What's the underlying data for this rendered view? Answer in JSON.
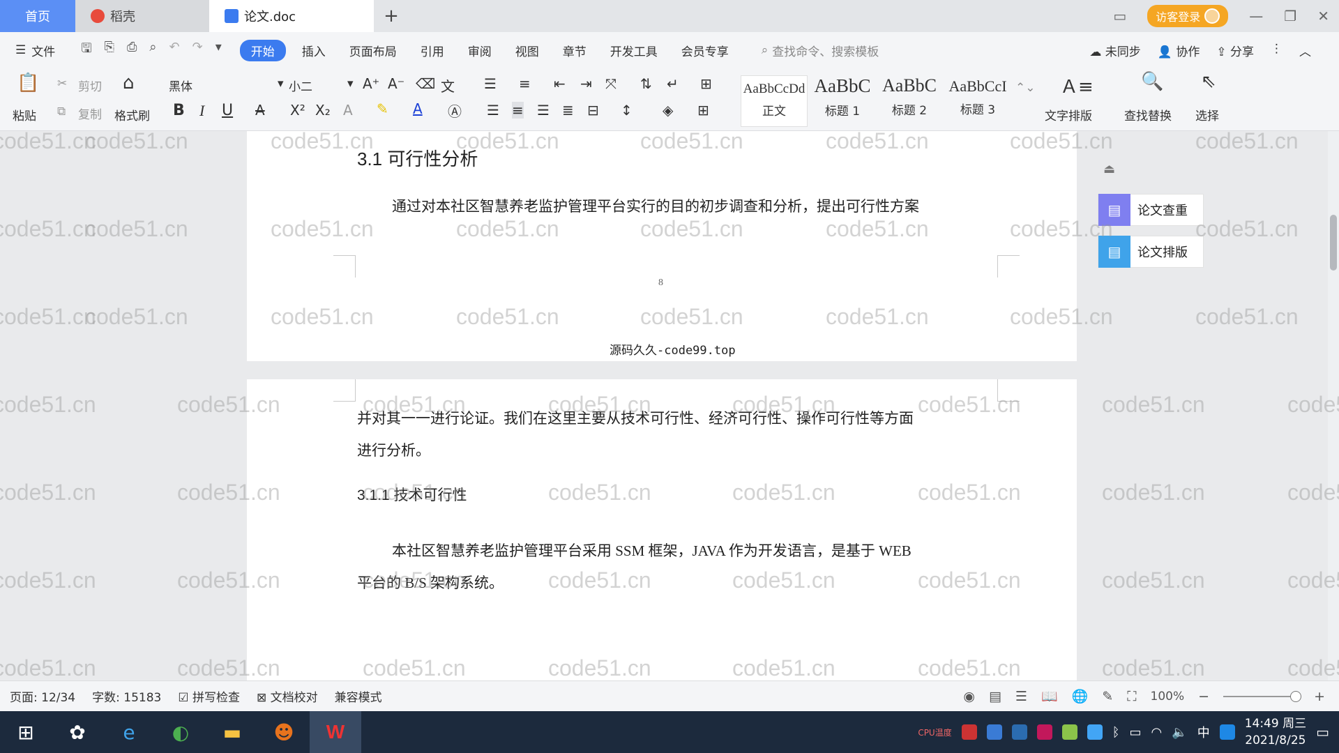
{
  "tabs": {
    "home": "首页",
    "daoke": "稻壳",
    "doc": "论文.doc",
    "new_tab": "+"
  },
  "window": {
    "login": "访客登录"
  },
  "menu": {
    "file": "文件",
    "items": [
      "开始",
      "插入",
      "页面布局",
      "引用",
      "审阅",
      "视图",
      "章节",
      "开发工具",
      "会员专享"
    ],
    "search_placeholder": "查找命令、搜索模板",
    "sync": "未同步",
    "collab": "协作",
    "share": "分享"
  },
  "ribbon": {
    "paste": "粘贴",
    "cut": "剪切",
    "copy": "复制",
    "format_painter": "格式刷",
    "font_name": "黑体",
    "font_size": "小二",
    "bold": "B",
    "italic": "I",
    "underline": "U",
    "styles": [
      {
        "sample": "AaBbCcDd",
        "name": "正文"
      },
      {
        "sample": "AaBbC",
        "name": "标题 1"
      },
      {
        "sample": "AaBbC",
        "name": "标题 2"
      },
      {
        "sample": "AaBbCcI",
        "name": "标题 3"
      }
    ],
    "text_layout": "文字排版",
    "find_replace": "查找替换",
    "select": "选择"
  },
  "document": {
    "heading_31": "3.1 可行性分析",
    "para1": "通过对本社区智慧养老监护管理平台实行的目的初步调查和分析，提出可行性方案",
    "page_number": "8",
    "header_text": "源码久久-code99.top",
    "para2_line1": "并对其一一进行论证。我们在这里主要从技术可行性、经济可行性、操作可行性等方面",
    "para2_line2": "进行分析。",
    "heading_311": "3.1.1 技术可行性",
    "para3_line1": "本社区智慧养老监护管理平台采用 SSM 框架，JAVA 作为开发语言，是基于 WEB",
    "para3_line2": "平台的 B/S 架构系统。",
    "watermark": "code51.cn"
  },
  "side_panel": {
    "check": "论文查重",
    "format": "论文排版"
  },
  "status": {
    "page": "页面: 12/34",
    "words": "字数: 15183",
    "spell": "拼写检查",
    "proof": "文档校对",
    "compat": "兼容模式",
    "zoom": "100%"
  },
  "taskbar": {
    "time": "14:49 周三",
    "date": "2021/8/25",
    "cpu": "CPU温度",
    "ime": "中"
  },
  "colors": {
    "accent": "#3b7bef",
    "home_tab": "#5b8ff5",
    "login": "#f5a623",
    "taskbar": "#1c2a3d"
  }
}
